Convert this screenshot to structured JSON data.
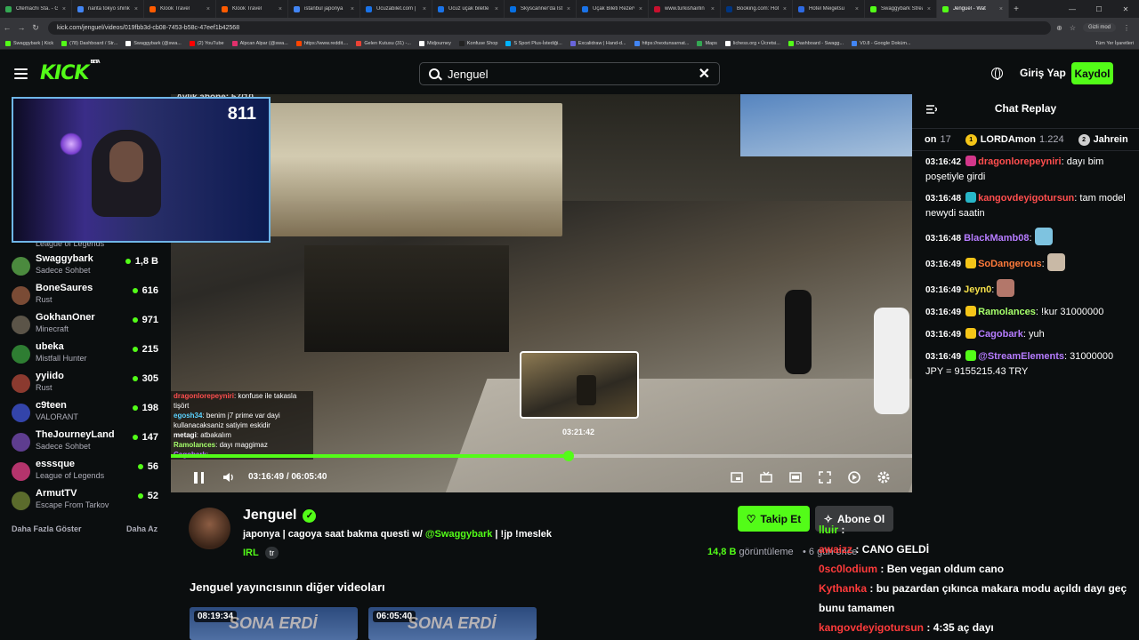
{
  "browser": {
    "tabs": [
      {
        "title": "Otemachi Sta. - Go",
        "color": "#34a853"
      },
      {
        "title": "narita tokyo shinka",
        "color": "#4285f4"
      },
      {
        "title": "Klook Travel",
        "color": "#ff5b00"
      },
      {
        "title": "Klook Travel",
        "color": "#ff5b00"
      },
      {
        "title": "istanbul japonya",
        "color": "#4285f4"
      },
      {
        "title": "Ucuzabilet.com |",
        "color": "#1a73e8"
      },
      {
        "title": "Ucuz uçak biletle",
        "color": "#1a73e8"
      },
      {
        "title": "Skyscanner'da İsta",
        "color": "#0770e3"
      },
      {
        "title": "Uçak Bileti Rezerv",
        "color": "#1a73e8"
      },
      {
        "title": "www.turkishairlin",
        "color": "#c8102e"
      },
      {
        "title": "Booking.com: Hote",
        "color": "#003580"
      },
      {
        "title": "Hotel Meigetsu",
        "color": "#2d6ae3"
      },
      {
        "title": "Swaggybark Strea",
        "color": "#53fc18"
      },
      {
        "title": "Jenguel - Wat",
        "color": "#53fc18",
        "active": true
      }
    ],
    "url": "kick.com/jenguel/videos/019fbb3d-cb08-7453-b58c-47eef1b42568",
    "incognito_label": "Gizli mod",
    "bookmarks": [
      "Swaggybark | Kick",
      "(78) Dashboard / Str...",
      "Swaggybark (@swa...",
      "(2) YouTube",
      "Alpcan Alpar (@swa...",
      "https://www.reddit....",
      "Gelen Kutusu (31) -...",
      "Midjourney",
      "Konfuse Shop",
      "S Sport Plus-İstediği...",
      "Excalidraw | Hand-d...",
      "https://nextunsarnat...",
      "Maps",
      "lichess.org • Ücretsi...",
      "Dashboard - Swagg...",
      "V0.8 - Google Doküm..."
    ],
    "all_bookmarks": "Tüm Yer İşaretleri"
  },
  "header": {
    "logo": "KICK",
    "logo_beta": "BETA",
    "search_value": "Jenguel",
    "login": "Giriş Yap",
    "register": "Kaydol"
  },
  "webcam": {
    "counter": "811"
  },
  "sidebar": {
    "fragment": "League of Legends",
    "items": [
      {
        "name": "Swaggybark",
        "category": "Sadece Sohbet",
        "viewers": "1,8 B",
        "avatar": "#4b8a3e"
      },
      {
        "name": "BoneSaures",
        "category": "Rust",
        "viewers": "616",
        "avatar": "#7a4b35"
      },
      {
        "name": "GokhanOner",
        "category": "Minecraft",
        "viewers": "971",
        "avatar": "#5b5448"
      },
      {
        "name": "ubeka",
        "category": "Mistfall Hunter",
        "viewers": "215",
        "avatar": "#2e7d32"
      },
      {
        "name": "yyiido",
        "category": "Rust",
        "viewers": "305",
        "avatar": "#8b3a2f"
      },
      {
        "name": "c9teen",
        "category": "VALORANT",
        "viewers": "198",
        "avatar": "#3344aa"
      },
      {
        "name": "TheJourneyLand",
        "category": "Sadece Sohbet",
        "viewers": "147",
        "avatar": "#5e3d8f"
      },
      {
        "name": "esssque",
        "category": "League of Legends",
        "viewers": "56",
        "avatar": "#b4346c"
      },
      {
        "name": "ArmutTV",
        "category": "Escape From Tarkov",
        "viewers": "52",
        "avatar": "#5b6b2c"
      }
    ],
    "show_more": "Daha Fazla Göster",
    "show_less": "Daha Az"
  },
  "player": {
    "top_label": "Aylık abone: 57/10",
    "overlay_chat": [
      {
        "user": "dragonlorepeyniri",
        "text": ": konfuse ile takasla tişört",
        "color": "#ff4e4e"
      },
      {
        "user": "egosh34",
        "text": ": benim j7 prime var dayi kullanacaksaniz satiyim eskidir",
        "color": "#5ad2ff"
      },
      {
        "user": "metagi",
        "text": ": atbakalım",
        "color": "#ffffff"
      },
      {
        "user": "Ramolances",
        "text": ": dayı maggimaz",
        "color": "#a6ff6b"
      },
      {
        "user": "Cagobark",
        "text": ":",
        "color": "#b67cff"
      }
    ],
    "preview_time": "03:21:42",
    "current_time": "03:16:49",
    "separator": "/",
    "duration": "06:05:40",
    "progress": 0.537,
    "hover": 0.553
  },
  "chat": {
    "title": "Chat Replay",
    "leaderboard": [
      {
        "name": "on",
        "count": "17",
        "rank": "",
        "color": "#ffffff"
      },
      {
        "name": "LORDAmon",
        "count": "1.224",
        "rank": "1",
        "color": "#f5c518"
      },
      {
        "name": "Jahrein",
        "count": "",
        "rank": "2",
        "color": "#cfcfcf"
      }
    ],
    "messages": [
      {
        "time": "03:16:42",
        "badge": "#d3378a",
        "user": "dragonlorepeyniri",
        "color": "#ff4e4e",
        "text": ": dayı bim poşetiyle girdi"
      },
      {
        "time": "03:16:48",
        "badge": "#28b6c8",
        "user": "kangovdeyigotursun",
        "color": "#ff4e4e",
        "text": ": tam model newydi saatin"
      },
      {
        "time": "03:16:48",
        "badge": "",
        "user": "BlackMamb08",
        "color": "#b67cff",
        "text": ":",
        "emote": "#7ec3e0"
      },
      {
        "time": "03:16:49",
        "badge": "#f5c518",
        "user": "SoDangerous",
        "color": "#ff7a3a",
        "text": ":",
        "emote": "#c9b9a6"
      },
      {
        "time": "03:16:49",
        "badge": "",
        "user": "Jeyn0",
        "color": "#f5e04a",
        "text": ":",
        "emote": "#b3776a"
      },
      {
        "time": "03:16:49",
        "badge": "#f5c518",
        "user": "Ramolances",
        "color": "#a6ff6b",
        "text": ": !kur 31000000"
      },
      {
        "time": "03:16:49",
        "badge": "#f5c518",
        "user": "Cagobark",
        "color": "#b67cff",
        "text": ": yuh"
      },
      {
        "time": "03:16:49",
        "badge": "#53fc18",
        "user": "@StreamElements",
        "color": "#b67cff",
        "text": ": 31000000 JPY = 9155215.43 TRY"
      }
    ]
  },
  "info": {
    "channel": "Jenguel",
    "title_prefix": "japonya | cagoya saat bakma questi w/",
    "mention": "@Swaggybark",
    "title_suffix": "| !jp !meslek",
    "category": "IRL",
    "tag": "tr",
    "follow": "Takip Et",
    "subscribe": "Abone Ol",
    "views": "14,8 B",
    "views_label": "görüntüleme",
    "date_ago": "• 6 gün önce",
    "other_videos": "Jenguel yayıncısının diğer videoları",
    "thumbs": [
      {
        "duration": "08:19:34",
        "title": "SONA ERDİ"
      },
      {
        "duration": "06:05:40",
        "title": "SONA ERDİ"
      }
    ]
  },
  "stream_overlay_chat": [
    {
      "user": "lluir",
      "color": "#53fc18",
      "text": ":"
    },
    {
      "user": "awaizz",
      "color": "#ff3b3b",
      "text": ": CANO GELDİ"
    },
    {
      "user": "0sc0lodium",
      "color": "#ff3b3b",
      "text": ": Ben vegan oldum cano"
    },
    {
      "user": "Kythanka",
      "color": "#ff3b3b",
      "text": ": bu pazardan çıkınca makara modu açıldı dayı geç bunu tamamen"
    },
    {
      "user": "kangovdeyigotursun",
      "color": "#ff3b3b",
      "text": ": 4:35 aç dayı"
    }
  ]
}
